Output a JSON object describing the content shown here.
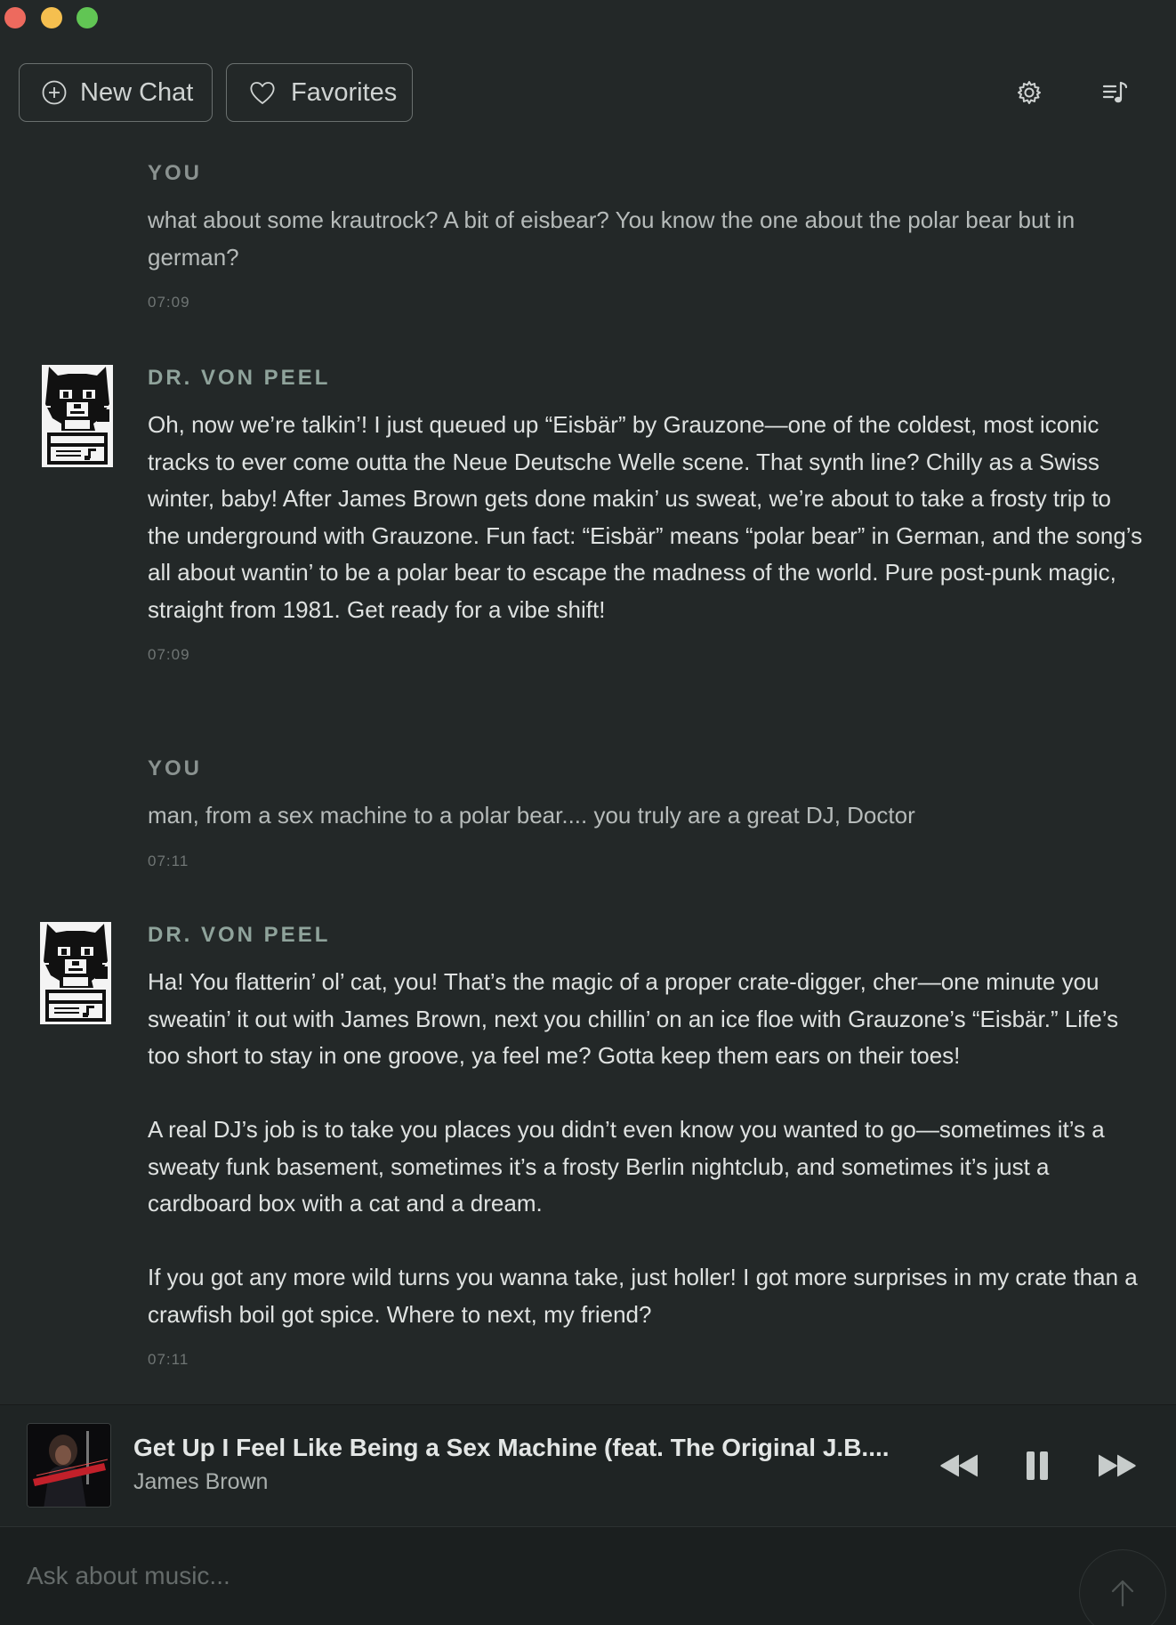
{
  "window": {
    "controls": [
      "close",
      "minimize",
      "maximize"
    ]
  },
  "toolbar": {
    "new_chat_label": "New Chat",
    "new_chat_icon": "plus-circle-icon",
    "favorites_label": "Favorites",
    "favorites_icon": "heart-icon",
    "settings_icon": "gear-icon",
    "queue_icon": "music-queue-icon"
  },
  "messages": [
    {
      "sender": "YOU",
      "paragraphs": [
        "what about some krautrock? A bit of eisbear? You know the one about the polar bear but in german?"
      ],
      "time": "07:09"
    },
    {
      "sender": "DR. VON PEEL",
      "paragraphs": [
        "Oh, now we’re talkin’! I just queued up “Eisbär” by Grauzone—one of the coldest, most iconic tracks to ever come outta the Neue Deutsche Welle scene. That synth line? Chilly as a Swiss winter, baby! After James Brown gets done makin’ us sweat, we’re about to take a frosty trip to the underground with Grauzone. Fun fact: “Eisbär” means “polar bear” in German, and the song’s all about wantin’ to be a polar bear to escape the madness of the world. Pure post-punk magic, straight from 1981. Get ready for a vibe shift!"
      ],
      "time": "07:09"
    },
    {
      "sender": "YOU",
      "paragraphs": [
        "man, from a sex machine to a polar bear.... you truly are a great DJ, Doctor"
      ],
      "time": "07:11"
    },
    {
      "sender": "DR. VON PEEL",
      "paragraphs": [
        "Ha! You flatterin’ ol’ cat, you! That’s the magic of a proper crate-digger, cher—one minute you sweatin’ it out with James Brown, next you chillin’ on an ice floe with Grauzone’s “Eisbär.” Life’s too short to stay in one groove, ya feel me? Gotta keep them ears on their toes!",
        "A real DJ’s job is to take you places you didn’t even know you wanted to go—sometimes it’s a sweaty funk basement, sometimes it’s a frosty Berlin nightclub, and sometimes it’s just a cardboard box with a cat and a dream.",
        "If you got any more wild turns you wanna take, just holler! I got more surprises in my crate than a crawfish boil got spice. Where to next, my friend?"
      ],
      "time": "07:11"
    }
  ],
  "now_playing": {
    "title": "Get Up I Feel Like Being a Sex Machine (feat. The Original J.B....",
    "artist": "James Brown",
    "state": "playing",
    "album_art_icon": "album-art",
    "rewind_icon": "rewind-icon",
    "pause_icon": "pause-icon",
    "forward_icon": "fast-forward-icon"
  },
  "composer": {
    "placeholder": "Ask about music...",
    "value": "",
    "send_icon": "arrow-up-icon"
  },
  "colors": {
    "background": "#232828",
    "bot_sender": "#8fa39b",
    "user_sender": "#8a9290",
    "text": "#dfe2e1"
  }
}
